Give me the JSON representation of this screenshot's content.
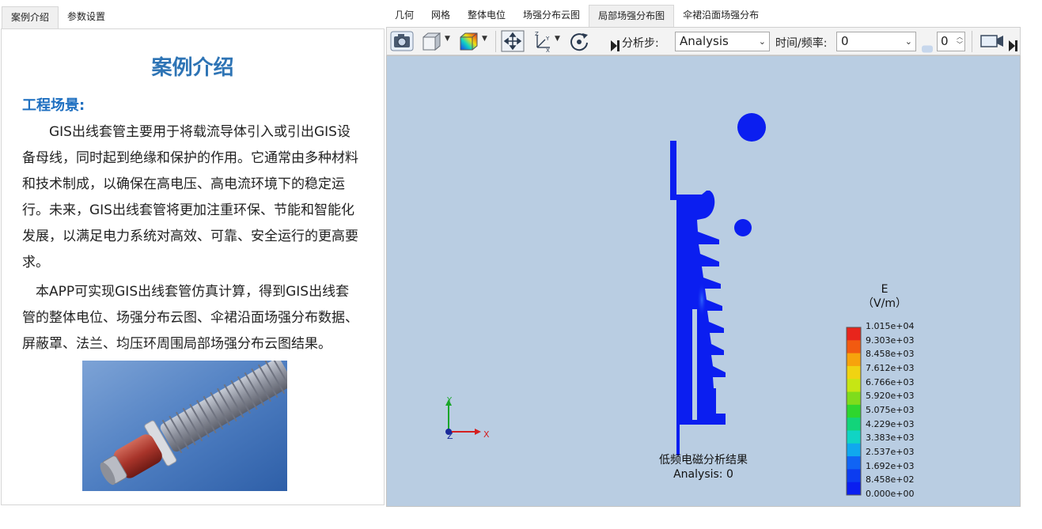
{
  "left_tabs": [
    "案例介绍",
    "参数设置"
  ],
  "case": {
    "title": "案例介绍",
    "heading": "工程场景:",
    "para1": "GIS出线套管主要用于将载流导体引入或引出GIS设备母线，同时起到绝缘和保护的作用。它通常由多种材料和技术制成，以确保在高电压、高电流环境下的稳定运行。未来，GIS出线套管将更加注重环保、节能和智能化发展，以满足电力系统对高效、可靠、安全运行的更高要求。",
    "para2": "本APP可实现GIS出线套管仿真计算，得到GIS出线套管的整体电位、场强分布云图、伞裙沿面场强分布数据、屏蔽罩、法兰、均压环周围局部场强分布云图结果。"
  },
  "right_tabs": [
    "几何",
    "网格",
    "整体电位",
    "场强分布云图",
    "局部场强分布图",
    "伞裙沿面场强分布"
  ],
  "toolbar": {
    "step_label": "分析步:",
    "step_value": "Analysis",
    "time_label": "时间/频率:",
    "time_value": "0",
    "spin_value": "0",
    "icons": [
      "camera-icon",
      "cube-icon",
      "colormap-icon",
      "fit-view-icon",
      "axes-icon",
      "rotate-icon",
      "video-icon",
      "play-icon"
    ]
  },
  "viewport": {
    "legend_title": "E",
    "legend_unit": "（V/m）",
    "legend_values": [
      "1.015e+04",
      "9.303e+03",
      "8.458e+03",
      "7.612e+03",
      "6.766e+03",
      "5.920e+03",
      "5.075e+03",
      "4.229e+03",
      "3.383e+03",
      "2.537e+03",
      "1.692e+03",
      "8.458e+02",
      "0.000e+00"
    ],
    "legend_colors": [
      "#e8251c",
      "#f25a10",
      "#f7a30c",
      "#f0d312",
      "#c6e614",
      "#7fdc1c",
      "#2ed62e",
      "#12d47a",
      "#10d4c4",
      "#10a8ee",
      "#1064f4",
      "#0c3cf0",
      "#0a1ef0"
    ],
    "caption_title": "低频电磁分析结果",
    "caption_sub": "Analysis: 0",
    "axis_x": "X",
    "axis_y": "Y",
    "axis_z": "Z",
    "geometry_color": "#0b1ef0"
  }
}
